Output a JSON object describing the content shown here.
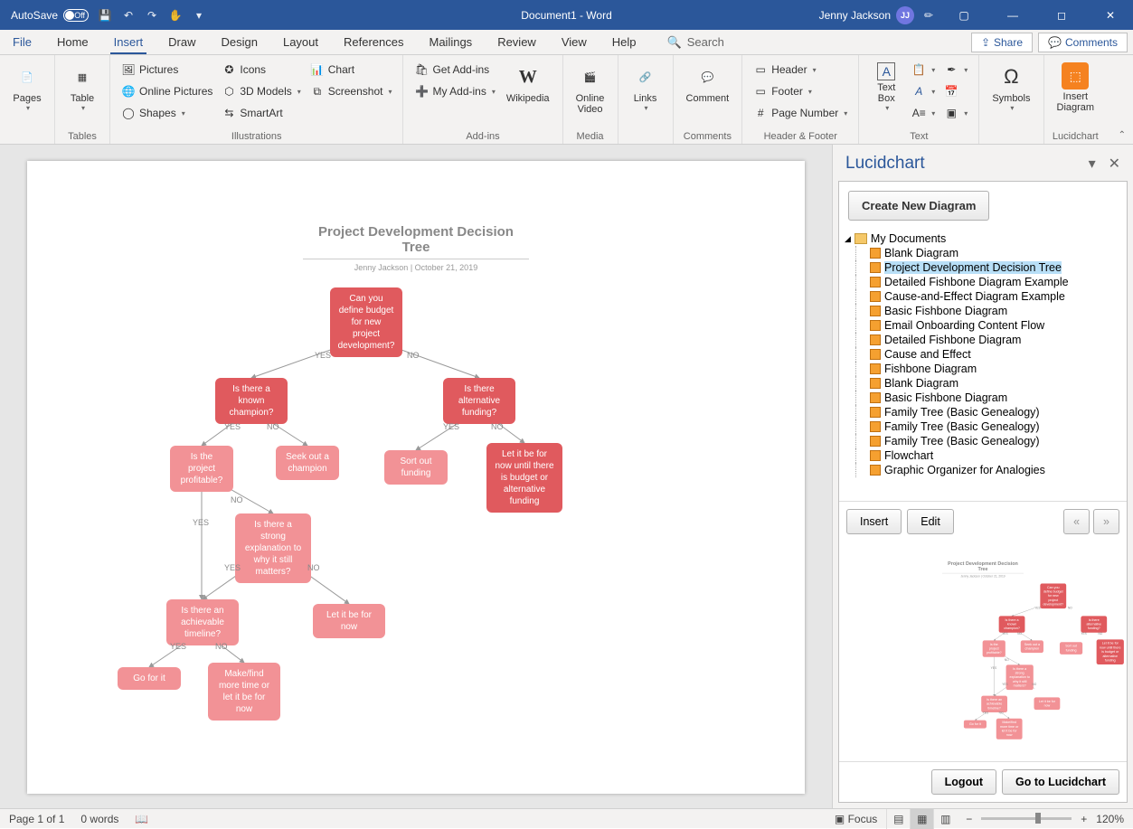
{
  "titlebar": {
    "autosave": "AutoSave",
    "autosave_state": "Off",
    "doc_title": "Document1  -  Word",
    "user_name": "Jenny Jackson",
    "user_initials": "JJ"
  },
  "tabs": {
    "file": "File",
    "home": "Home",
    "insert": "Insert",
    "draw": "Draw",
    "design": "Design",
    "layout": "Layout",
    "references": "References",
    "mailings": "Mailings",
    "review": "Review",
    "view": "View",
    "help": "Help",
    "search": "Search",
    "share": "Share",
    "comments": "Comments"
  },
  "ribbon": {
    "pages": "Pages",
    "table": "Table",
    "tables_group": "Tables",
    "pictures": "Pictures",
    "online_pictures": "Online Pictures",
    "shapes": "Shapes",
    "icons": "Icons",
    "models": "3D Models",
    "smartart": "SmartArt",
    "chart": "Chart",
    "screenshot": "Screenshot",
    "illustrations_group": "Illustrations",
    "get_addins": "Get Add-ins",
    "my_addins": "My Add-ins",
    "wikipedia": "Wikipedia",
    "addins_group": "Add-ins",
    "online_video_1": "Online",
    "online_video_2": "Video",
    "media_group": "Media",
    "links": "Links",
    "comment": "Comment",
    "comments_group": "Comments",
    "header": "Header",
    "footer": "Footer",
    "page_number": "Page Number",
    "hf_group": "Header & Footer",
    "text_box_1": "Text",
    "text_box_2": "Box",
    "text_group": "Text",
    "symbols": "Symbols",
    "insert_diagram_1": "Insert",
    "insert_diagram_2": "Diagram",
    "lucidchart_group": "Lucidchart"
  },
  "flowchart": {
    "title": "Project Development Decision Tree",
    "subtitle": "Jenny Jackson  |  October 21, 2019",
    "n1": "Can you define budget for new project development?",
    "n2": "Is there a known champion?",
    "n3": "Is there alternative funding?",
    "n4": "Is the project profitable?",
    "n5": "Seek out a champion",
    "n6": "Sort out funding",
    "n7": "Let it be for now until there is budget or alternative funding",
    "n8": "Is there a strong explanation to why it still matters?",
    "n9": "Is there an achievable timeline?",
    "n10": "Let it be for now",
    "n11": "Go for it",
    "n12": "Make/find more time or let it be for now",
    "yes": "YES",
    "no": "NO"
  },
  "panel": {
    "title": "Lucidchart",
    "create": "Create New Diagram",
    "folder": "My Documents",
    "items": [
      "Blank Diagram",
      "Project Development Decision Tree",
      "Detailed Fishbone Diagram Example",
      "Cause-and-Effect Diagram Example",
      "Basic Fishbone Diagram",
      "Email Onboarding Content Flow",
      "Detailed Fishbone Diagram",
      "Cause and Effect",
      "Fishbone Diagram",
      "Blank Diagram",
      "Basic Fishbone Diagram",
      "Family Tree (Basic Genealogy)",
      "Family Tree (Basic Genealogy)",
      "Family Tree (Basic Genealogy)",
      "Flowchart",
      "Graphic Organizer for Analogies"
    ],
    "selected_index": 1,
    "insert": "Insert",
    "edit": "Edit",
    "prev": "«",
    "next": "»",
    "logout": "Logout",
    "goto": "Go to Lucidchart"
  },
  "statusbar": {
    "page": "Page 1 of 1",
    "words": "0 words",
    "focus": "Focus",
    "zoom": "120%"
  }
}
